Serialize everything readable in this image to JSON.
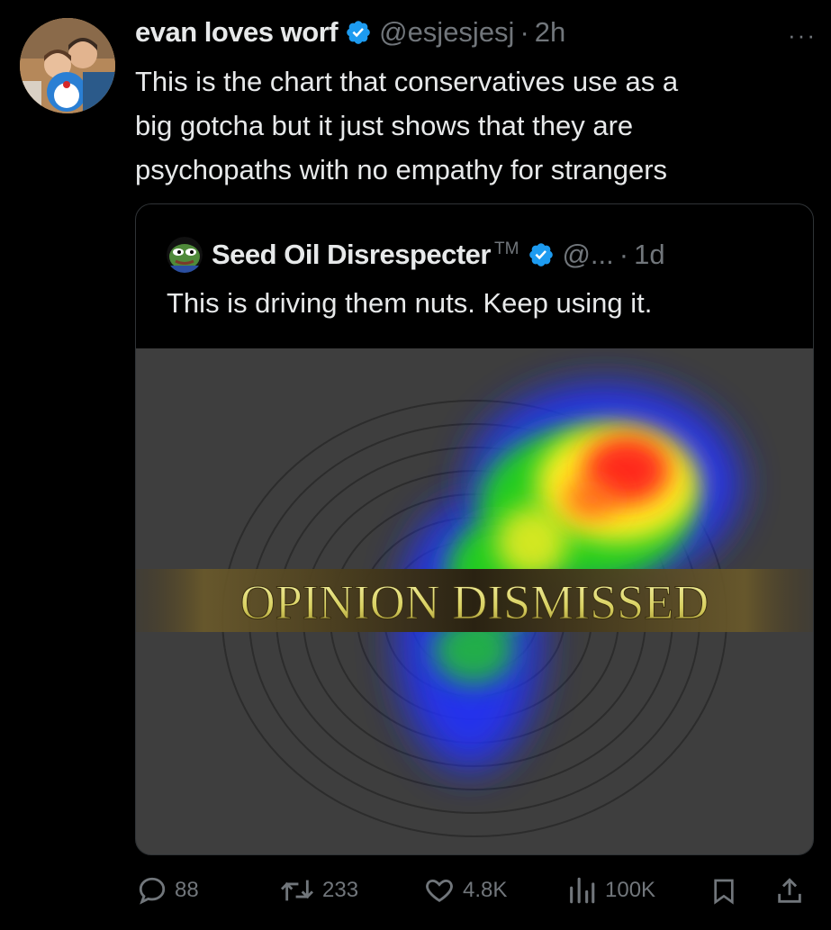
{
  "tweet": {
    "display_name": "evan loves worf",
    "handle": "@esjesjesj",
    "time": "2h",
    "text_lines": [
      "This is the chart that conservatives use as a",
      "big gotcha but it just shows that they are",
      "psychopaths with no empathy for strangers"
    ]
  },
  "quote": {
    "display_name": "Seed Oil Disrespecter",
    "trademark": "TM",
    "handle": "@...",
    "time": "1d",
    "text": "This is driving them nuts. Keep using it.",
    "media_caption": "OPINION DISMISSED"
  },
  "actions": {
    "replies": "88",
    "reposts": "233",
    "likes": "4.8K",
    "views": "100K"
  },
  "icons": {
    "verified": "verified-badge-icon",
    "more": "more-icon",
    "reply": "reply-icon",
    "repost": "repost-icon",
    "like": "heart-icon",
    "views": "views-icon",
    "bookmark": "bookmark-icon",
    "share": "share-icon"
  },
  "colors": {
    "accent": "#1d9bf0",
    "muted": "#71767b",
    "text": "#e7e9ea",
    "bg": "#000000"
  }
}
